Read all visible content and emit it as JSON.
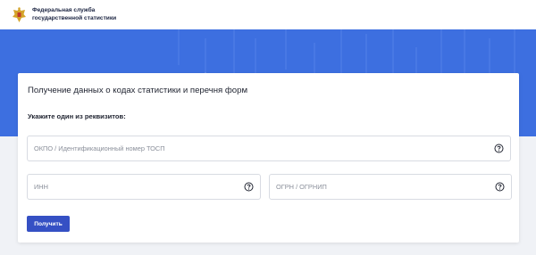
{
  "header": {
    "org_line1": "Федеральная служба",
    "org_line2": "государственной статистики",
    "emblem_icon": "coat-of-arms-icon"
  },
  "colors": {
    "banner_blue": "#3d6fe0",
    "button_blue": "#3550c4",
    "background": "#f0f2f6"
  },
  "form": {
    "title": "Получение данных о кодах статистики и перечня форм",
    "hint": "Укажите один из реквизитов:",
    "fields": {
      "okpo": {
        "placeholder": "ОКПО / Идентификационный номер ТОСП",
        "value": ""
      },
      "inn": {
        "placeholder": "ИНН",
        "value": ""
      },
      "ogrn": {
        "placeholder": "ОГРН / ОГРНИП",
        "value": ""
      }
    },
    "help_icon": "question-circle-icon",
    "submit_label": "Получить"
  }
}
